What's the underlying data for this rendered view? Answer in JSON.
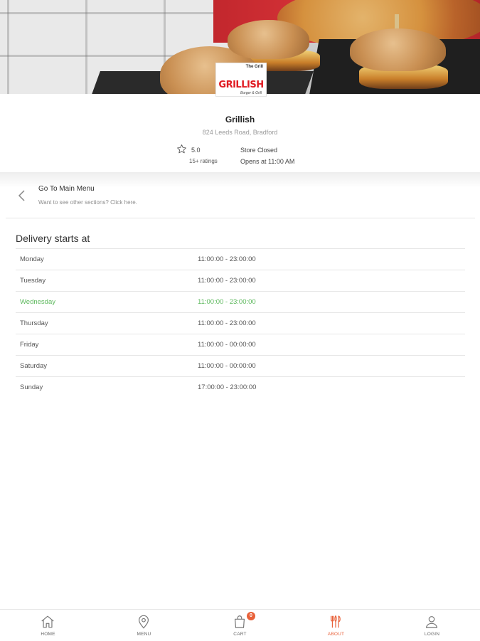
{
  "store": {
    "name": "Grillish",
    "address": "824 Leeds Road, Bradford",
    "rating": "5.0",
    "rating_count": "15+ ratings",
    "status": "Store Closed",
    "opens": "Opens at 11:00 AM"
  },
  "logo": {
    "small_text": "The Grill",
    "wordmark": "GRILLISH",
    "tagline": "Burger & Grill"
  },
  "back_link": {
    "title": "Go To Main Menu",
    "subtitle": "Want to see other sections? Click here."
  },
  "hours": {
    "heading": "Delivery starts at",
    "rows": [
      {
        "day": "Monday",
        "time": "11:00:00 - 23:00:00",
        "today": false
      },
      {
        "day": "Tuesday",
        "time": "11:00:00 - 23:00:00",
        "today": false
      },
      {
        "day": "Wednesday",
        "time": "11:00:00 - 23:00:00",
        "today": true
      },
      {
        "day": "Thursday",
        "time": "11:00:00 - 23:00:00",
        "today": false
      },
      {
        "day": "Friday",
        "time": "11:00:00 - 00:00:00",
        "today": false
      },
      {
        "day": "Saturday",
        "time": "11:00:00 - 00:00:00",
        "today": false
      },
      {
        "day": "Sunday",
        "time": "17:00:00 - 23:00:00",
        "today": false
      }
    ]
  },
  "nav": {
    "items": [
      {
        "label": "HOME",
        "icon": "home-icon"
      },
      {
        "label": "MENU",
        "icon": "location-pin-icon"
      },
      {
        "label": "CART",
        "icon": "cart-bag-icon",
        "badge": "0"
      },
      {
        "label": "ABOUT",
        "icon": "cutlery-icon",
        "active": true
      },
      {
        "label": "LOGIN",
        "icon": "user-icon"
      }
    ]
  },
  "colors": {
    "accent": "#e8613a",
    "today": "#5cb85c",
    "logo_red": "#e01b22"
  }
}
